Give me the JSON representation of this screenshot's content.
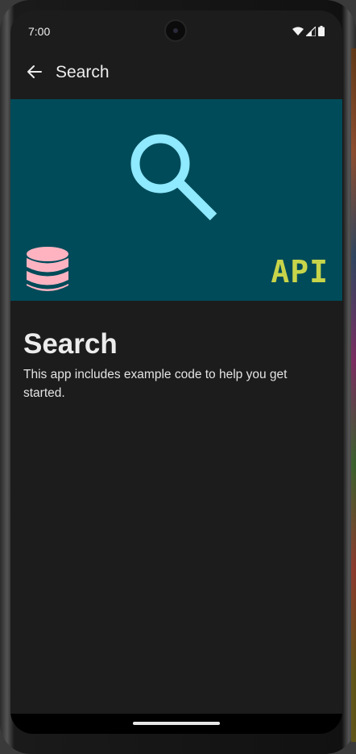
{
  "status_bar": {
    "time": "7:00",
    "icons": [
      "wifi-icon",
      "signal-icon",
      "battery-icon"
    ]
  },
  "app_bar": {
    "title": "Search",
    "back_icon": "arrow-left-icon"
  },
  "hero": {
    "background": "#004b59",
    "search_icon_color": "#8fe9ff",
    "database_icon_color": "#ffb3c1",
    "api_label": "API",
    "api_color": "#c8d54a"
  },
  "content": {
    "title": "Search",
    "body": "This app includes example code to help you get started."
  }
}
